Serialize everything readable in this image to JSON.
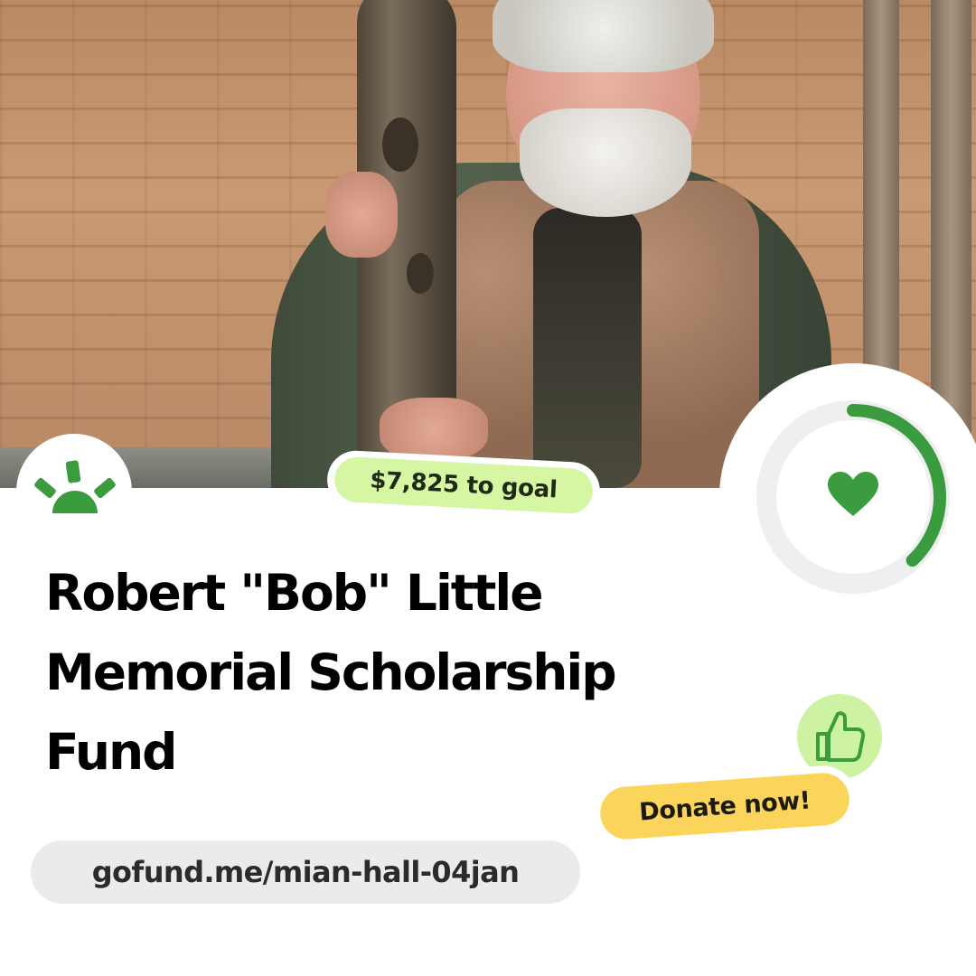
{
  "campaign": {
    "goal_remaining_text": "$7,825 to goal",
    "title_lines": [
      "Robert \"Bob\" Little",
      "Memorial Scholarship",
      "Fund"
    ],
    "cta_label": "Donate now!",
    "url": "gofund.me/mian-hall-04jan",
    "progress_fraction": 0.38
  },
  "icons": {
    "logo": "gofundme-sunrise-logo",
    "heart": "heart-icon",
    "thumb": "thumbs-up-icon"
  },
  "colors": {
    "brand_green": "#3a9b3f",
    "ring_track": "#efefef",
    "goal_pill": "#d6f6a3",
    "donate_pill": "#fbd55b",
    "thumb_bg": "#cdf2a1",
    "url_pill": "#ebebeb"
  }
}
